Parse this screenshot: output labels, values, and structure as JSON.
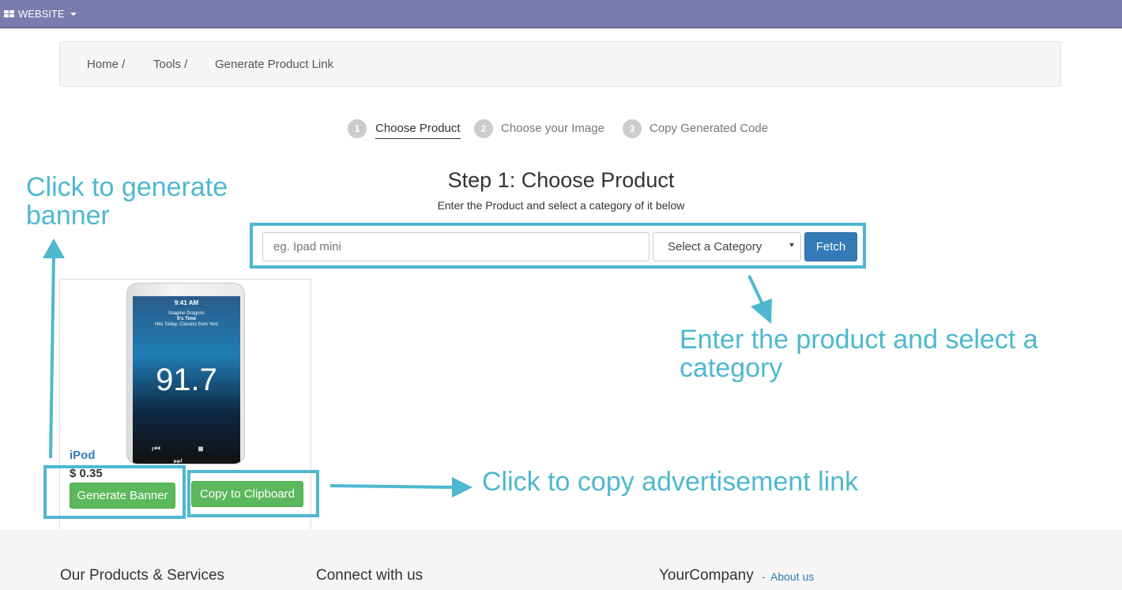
{
  "topbar": {
    "menu_label": "WEBSITE",
    "menu_icon": "grid-icon"
  },
  "breadcrumb": {
    "items": [
      "Home /",
      "Tools /",
      "Generate Product Link"
    ]
  },
  "steps": [
    {
      "num": "1",
      "label": "Choose Product",
      "active": true
    },
    {
      "num": "2",
      "label": "Choose your Image",
      "active": false
    },
    {
      "num": "3",
      "label": "Copy Generated Code",
      "active": false
    }
  ],
  "main": {
    "title": "Step 1: Choose Product",
    "subtitle": "Enter the Product and select a category of it below",
    "search_placeholder": "eg. Ipad mini",
    "category_selected": "Select a Category",
    "fetch_label": "Fetch"
  },
  "product": {
    "name": "iPod",
    "price": "$ 0.35",
    "generate_label": "Generate Banner",
    "copy_label": "Copy to Clipboard",
    "image": {
      "status": "9:41 AM",
      "artist": "Imagine Dragons",
      "song": "It's Time",
      "station": "Hits Today, Classics from Yest",
      "frequency": "91.7",
      "controls": "⏮ ■ ⏭"
    }
  },
  "annotations": {
    "generate": "Click to generate banner",
    "enter": "Enter the product and select a category",
    "copy": "Click to copy advertisement link",
    "color": "#4db8d0"
  },
  "footer": {
    "col1": "Our Products & Services",
    "col2": "Connect with us",
    "col3_company": "YourCompany",
    "col3_dash": "-",
    "col3_about": "About us"
  },
  "colors": {
    "topbar": "#7c7bad",
    "primary": "#337ab7",
    "success": "#5cb85c",
    "annotation": "#4db8d0"
  }
}
